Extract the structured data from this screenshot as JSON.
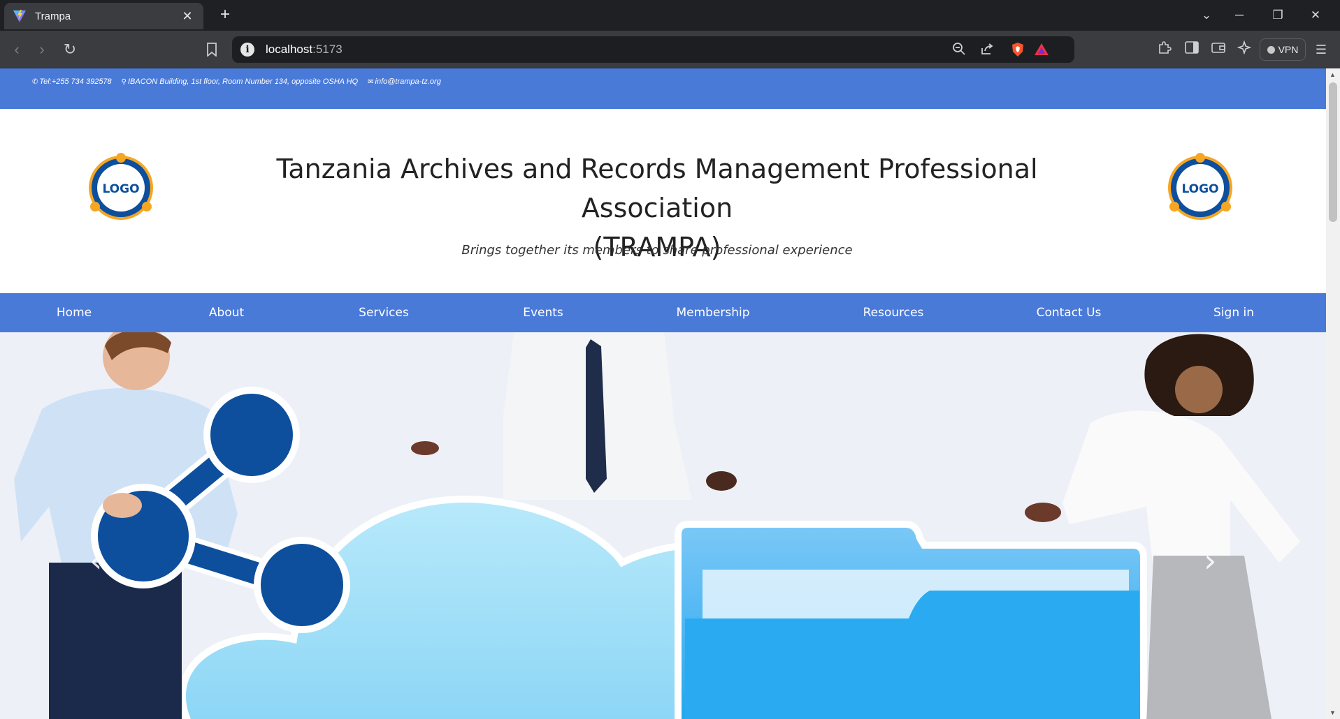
{
  "browser": {
    "tab_title": "Trampa",
    "url_host": "localhost",
    "url_port": ":5173",
    "vpn_label": "VPN"
  },
  "topbar": {
    "phone": "Tel:+255 734 392578",
    "address": "IBACON Building, 1st floor, Room Number 134, opposite OSHA HQ",
    "email": "info@trampa-tz.org"
  },
  "header": {
    "logo_text": "LOGO",
    "title_line1": "Tanzania Archives and Records Management Professional Association",
    "title_line2": "(TRAMPA)",
    "tagline": "Brings together its members to share professional experience"
  },
  "nav": {
    "items": [
      "Home",
      "About",
      "Services",
      "Events",
      "Membership",
      "Resources",
      "Contact Us",
      "Sign in"
    ]
  },
  "colors": {
    "brand_blue": "#4a7ad8",
    "logo_navy": "#0d4f9c",
    "logo_orange": "#f5a623"
  }
}
